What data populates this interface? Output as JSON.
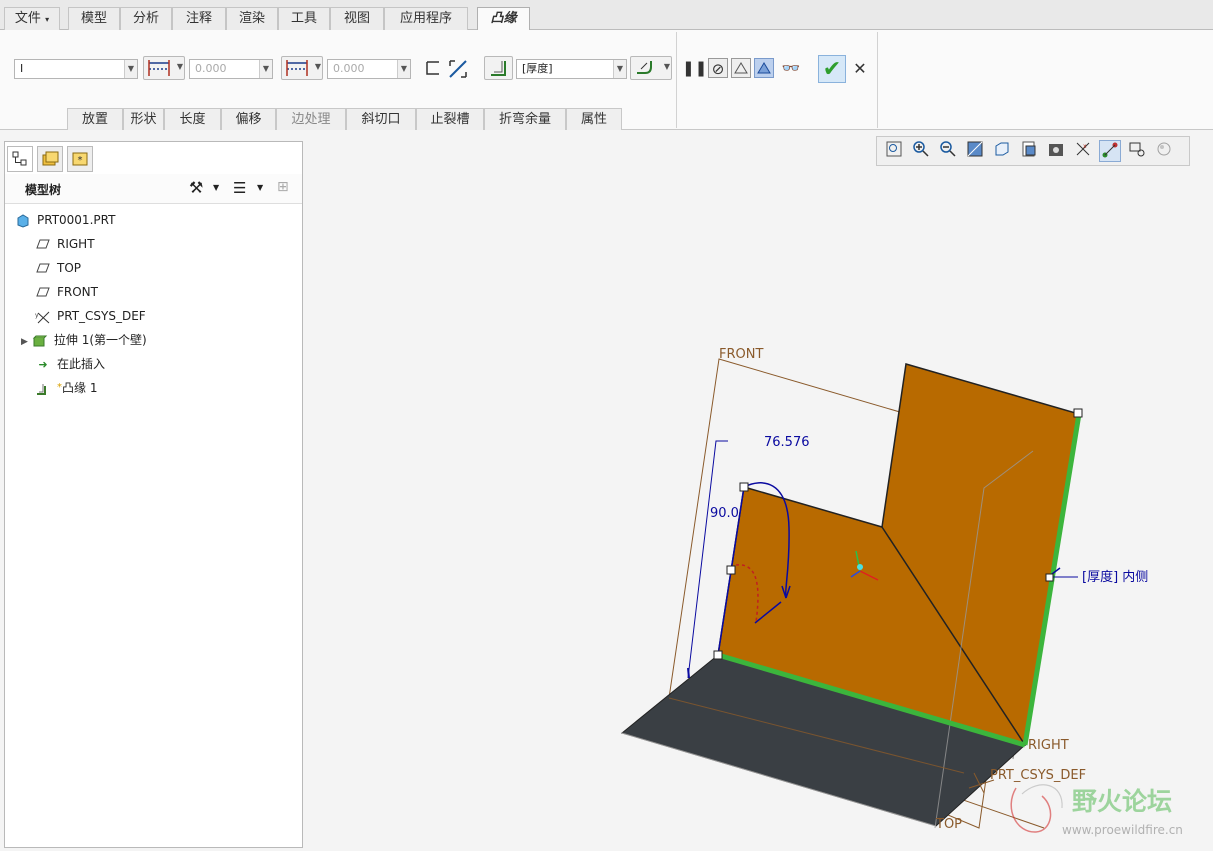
{
  "ribbon_tabs": [
    "文件",
    "模型",
    "分析",
    "注释",
    "渲染",
    "工具",
    "视图",
    "应用程序",
    "凸缘"
  ],
  "dashboard": {
    "shape_value": "I",
    "length1_value": "0.000",
    "length2_value": "0.000",
    "thickness_value": "[厚度]"
  },
  "subtabs": [
    "放置",
    "形状",
    "长度",
    "偏移",
    "边处理",
    "斜切口",
    "止裂槽",
    "折弯余量",
    "属性"
  ],
  "model_tree": {
    "title": "模型树",
    "items": [
      {
        "label": "PRT0001.PRT",
        "icon": "part-icon"
      },
      {
        "label": "RIGHT",
        "icon": "datum-plane-icon"
      },
      {
        "label": "TOP",
        "icon": "datum-plane-icon"
      },
      {
        "label": "FRONT",
        "icon": "datum-plane-icon"
      },
      {
        "label": "PRT_CSYS_DEF",
        "icon": "csys-icon"
      },
      {
        "label": "拉伸 1(第一个壁)",
        "icon": "extrude-icon"
      },
      {
        "label": "在此插入",
        "icon": "insert-arrow-icon"
      },
      {
        "label": "凸缘 1",
        "icon": "flange-icon"
      }
    ]
  },
  "viewport": {
    "dimension_length": "76.576",
    "dimension_angle": "90.0",
    "thickness_note": "[厚度] 内侧",
    "plane_front": "FRONT",
    "plane_right": "RIGHT",
    "plane_top": "TOP",
    "csys_label": "PRT_CSYS_DEF"
  },
  "watermark": {
    "text": "野火论坛",
    "url": "www.proewildfire.cn"
  },
  "colors": {
    "wall_orange": "#b86a00",
    "base_dark": "#3a3f44",
    "edge_green": "#3cb53c",
    "dimension_blue": "#0a0aa0",
    "datum_brown": "#8a5a2b",
    "accept_green": "#2e9e2e"
  }
}
